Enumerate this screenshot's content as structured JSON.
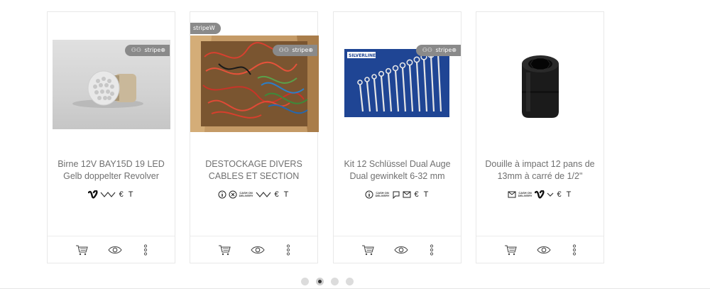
{
  "products": [
    {
      "title": "Birne 12V BAY15D 19 LED Gelb doppelter Revolver",
      "image": "led-bulb-photo",
      "badge": "Stripe",
      "payments": [
        "vimeo-icon",
        "wave-icon",
        "€",
        "T"
      ]
    },
    {
      "title": "DESTOCKAGE DIVERS CABLES ET SECTION",
      "image": "box-of-cables-photo",
      "badge": "Stripe",
      "corner_badge": "stripeW",
      "payments": [
        "info-icon",
        "circle-x-icon",
        "CASH ON DELIVERY",
        "wave-icon",
        "€",
        "T"
      ]
    },
    {
      "title": "Kit 12 Schlüssel Dual Auge Dual gewinkelt 6-32 mm",
      "image": "wrench-set-photo",
      "badge": "Stripe",
      "payments": [
        "info-icon",
        "CASH ON DELIVERY",
        "chat-icon",
        "envelope-icon",
        "€",
        "T"
      ]
    },
    {
      "title": "Douille à impact 12 pans de 13mm à carré de 1/2\"",
      "image": "impact-socket-photo",
      "payments": [
        "envelope-icon",
        "CASH ON DELIVERY",
        "vimeo-icon",
        "chevron-icon",
        "€",
        "T"
      ]
    }
  ],
  "payment_text": {
    "cod_line1": "CASH ON",
    "cod_line2": "DELIVERY",
    "euro": "€",
    "t": "T",
    "stripe": "stripe"
  },
  "pagination": {
    "pages": 4,
    "active": 2
  },
  "colors": {
    "badge": "#8a8a8a",
    "border": "#e8e8e8",
    "title": "#707070",
    "active_dot": "#333333"
  }
}
